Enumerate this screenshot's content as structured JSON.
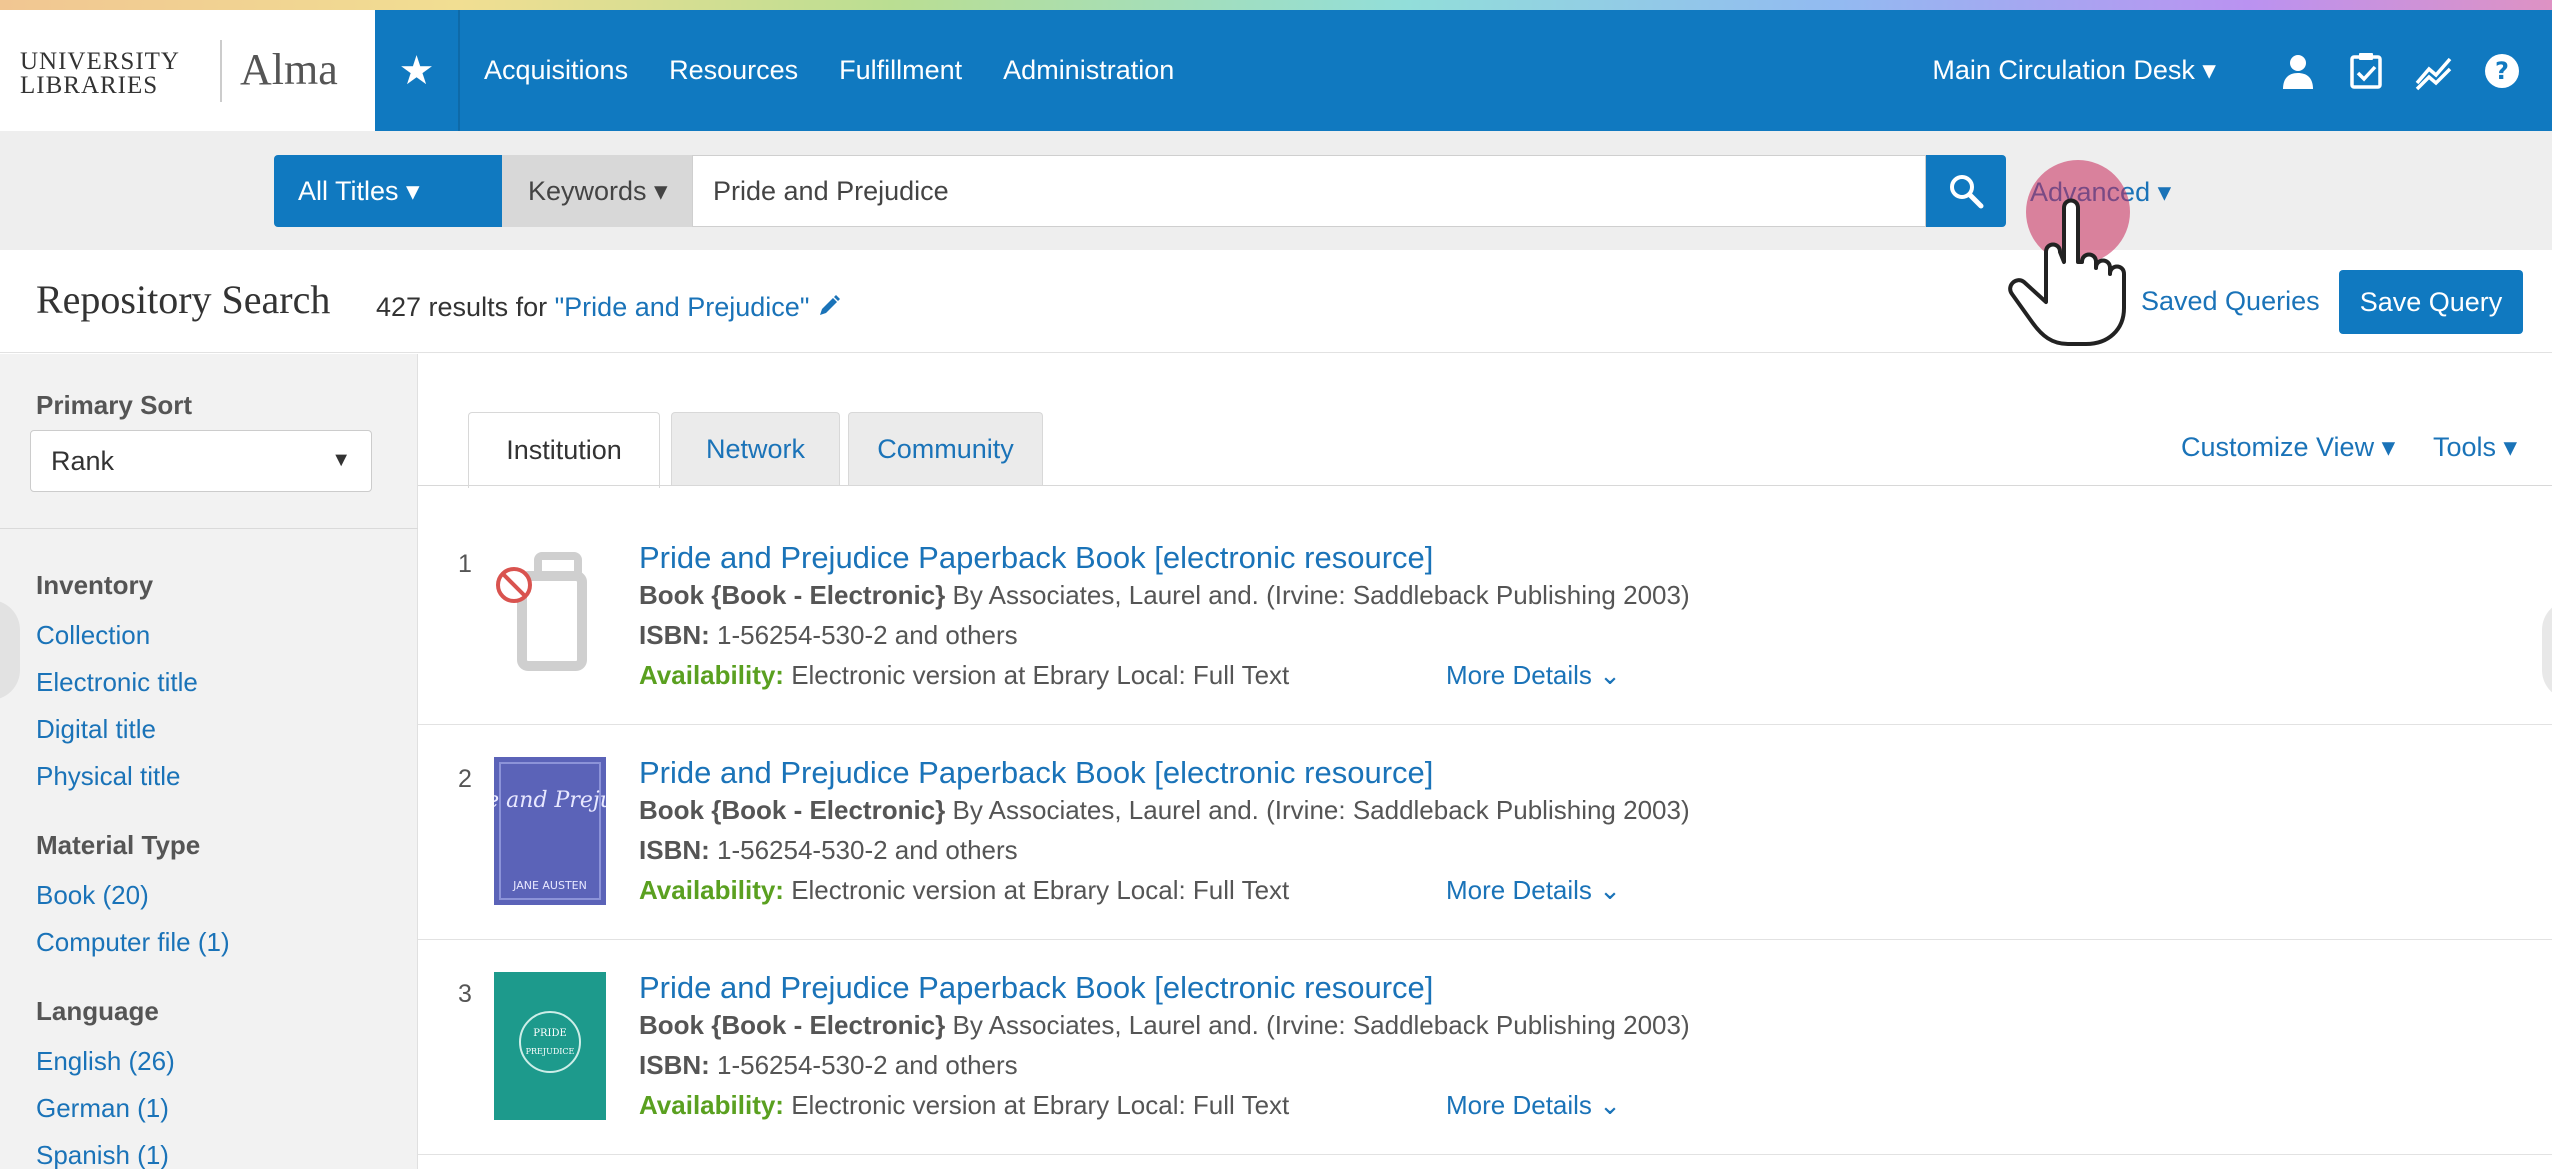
{
  "header": {
    "logo_univ_line1": "UNIVERSITY",
    "logo_univ_line2": "LIBRARIES",
    "logo_app": "Alma",
    "nav": [
      "Acquisitions",
      "Resources",
      "Fulfillment",
      "Administration"
    ],
    "desk": "Main Circulation Desk ▾",
    "icons": [
      "star-icon",
      "user-icon",
      "tasks-icon",
      "analytics-icon",
      "help-icon"
    ],
    "brand_color": "#1079c0"
  },
  "search": {
    "scope": "All Titles ▾",
    "field": "Keywords ▾",
    "query": "Pride and Prejudice",
    "advanced": "Advanced ▾"
  },
  "titlebar": {
    "title": "Repository Search",
    "results_prefix": "427 results for ",
    "results_query": "\"Pride and Prejudice\"",
    "saved_queries": "Saved Queries",
    "save_query": "Save Query"
  },
  "sidebar": {
    "sort_label": "Primary Sort",
    "sort_value": "Rank",
    "facets": [
      {
        "heading": "Inventory",
        "links": [
          "Collection",
          "Electronic title",
          "Digital title",
          "Physical title"
        ]
      },
      {
        "heading": "Material Type",
        "links": [
          "Book (20)",
          "Computer file (1)"
        ]
      },
      {
        "heading": "Language",
        "links": [
          "English (26)",
          "German (1)",
          "Spanish (1)"
        ]
      }
    ]
  },
  "tabs": [
    "Institution",
    "Network",
    "Community"
  ],
  "toolbar": {
    "customize_view": "Customize View ▾",
    "tools": "Tools ▾"
  },
  "results": [
    {
      "num": "1",
      "title": "Pride and Prejudice Paperback Book [electronic resource]",
      "type": "Book {Book - Electronic}",
      "by": " By Associates, Laurel and. (Irvine: Saddleback Publishing 2003)",
      "isbn_label": "ISBN:",
      "isbn": " 1-56254-530-2 and others",
      "avail_label": "Availability:",
      "avail": " Electronic version at Ebrary Local: Full Text",
      "more": "More Details ⌄"
    },
    {
      "num": "2",
      "title": "Pride and Prejudice Paperback Book [electronic resource]",
      "type": "Book {Book - Electronic}",
      "by": " By Associates, Laurel and. (Irvine: Saddleback Publishing 2003)",
      "isbn_label": "ISBN:",
      "isbn": " 1-56254-530-2 and others",
      "avail_label": "Availability:",
      "avail": " Electronic version at Ebrary Local: Full Text",
      "more": "More Details ⌄"
    },
    {
      "num": "3",
      "title": "Pride and Prejudice Paperback Book [electronic resource]",
      "type": "Book {Book - Electronic}",
      "by": " By Associates, Laurel and. (Irvine: Saddleback Publishing 2003)",
      "isbn_label": "ISBN:",
      "isbn": " 1-56254-530-2 and others",
      "avail_label": "Availability:",
      "avail": " Electronic version at Ebrary Local: Full Text",
      "more": "More Details ⌄"
    }
  ],
  "covers": {
    "cover2_title": "Pride and Prejudice",
    "cover2_author": "JANE AUSTEN",
    "cover3_line1": "PRIDE",
    "cover3_line2": "PREJUDICE"
  }
}
